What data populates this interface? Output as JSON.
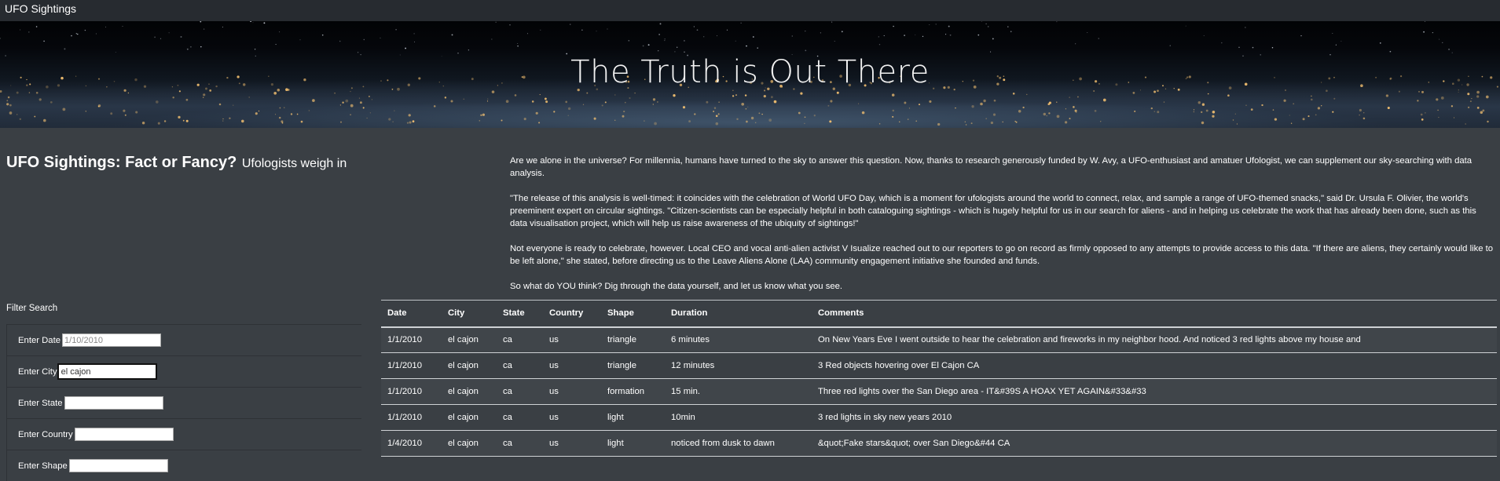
{
  "navbar": {
    "brand": "UFO Sightings"
  },
  "hero": {
    "title": "The Truth is Out There"
  },
  "heading": {
    "main": "UFO Sightings: Fact or Fancy?",
    "sub": "Ufologists weigh in"
  },
  "article": {
    "paragraphs": [
      "Are we alone in the universe? For millennia, humans have turned to the sky to answer this question. Now, thanks to research generously funded by W. Avy, a UFO-enthusiast and amatuer Ufologist, we can supplement our sky-searching with data analysis.",
      "\"The release of this analysis is well-timed: it coincides with the celebration of World UFO Day, which is a moment for ufologists around the world to connect, relax, and sample a range of UFO-themed snacks,\" said Dr. Ursula F. Olivier, the world's preeminent expert on circular sightings. \"Citizen-scientists can be especially helpful in both cataloguing sightings - which is hugely helpful for us in our search for aliens - and in helping us celebrate the work that has already been done, such as this data visualisation project, which will help us raise awareness of the ubiquity of sightings!\"",
      "Not everyone is ready to celebrate, however. Local CEO and vocal anti-alien activist V Isualize reached out to our reporters to go on record as firmly opposed to any attempts to provide access to this data. \"If there are aliens, they certainly would like to be left alone,\" she stated, before directing us to the Leave Aliens Alone (LAA) community engagement initiative she founded and funds.",
      "So what do YOU think? Dig through the data yourself, and let us know what you see."
    ]
  },
  "filters": {
    "title": "Filter Search",
    "date": {
      "label": "Enter Date",
      "placeholder": "1/10/2010",
      "value": ""
    },
    "city": {
      "label": "Enter City",
      "placeholder": "",
      "value": "el cajon"
    },
    "state": {
      "label": "Enter State",
      "placeholder": "",
      "value": ""
    },
    "country": {
      "label": "Enter Country",
      "placeholder": "",
      "value": ""
    },
    "shape": {
      "label": "Enter Shape",
      "placeholder": "",
      "value": ""
    }
  },
  "table": {
    "headers": [
      "Date",
      "City",
      "State",
      "Country",
      "Shape",
      "Duration",
      "Comments"
    ],
    "rows": [
      [
        "1/1/2010",
        "el cajon",
        "ca",
        "us",
        "triangle",
        "6 minutes",
        "On New Years Eve I went outside to hear the celebration and fireworks in my neighbor hood. And noticed 3 red lights above my house and"
      ],
      [
        "1/1/2010",
        "el cajon",
        "ca",
        "us",
        "triangle",
        "12 minutes",
        "3 Red objects hovering over El Cajon CA"
      ],
      [
        "1/1/2010",
        "el cajon",
        "ca",
        "us",
        "formation",
        "15 min.",
        "Three red lights over the San Diego area - IT&#39S A HOAX YET AGAIN&#33&#33"
      ],
      [
        "1/1/2010",
        "el cajon",
        "ca",
        "us",
        "light",
        "10min",
        "3 red lights in sky new years 2010"
      ],
      [
        "1/4/2010",
        "el cajon",
        "ca",
        "us",
        "light",
        "noticed from dusk to dawn",
        "&quot;Fake stars&quot; over San Diego&#44 CA"
      ]
    ]
  }
}
